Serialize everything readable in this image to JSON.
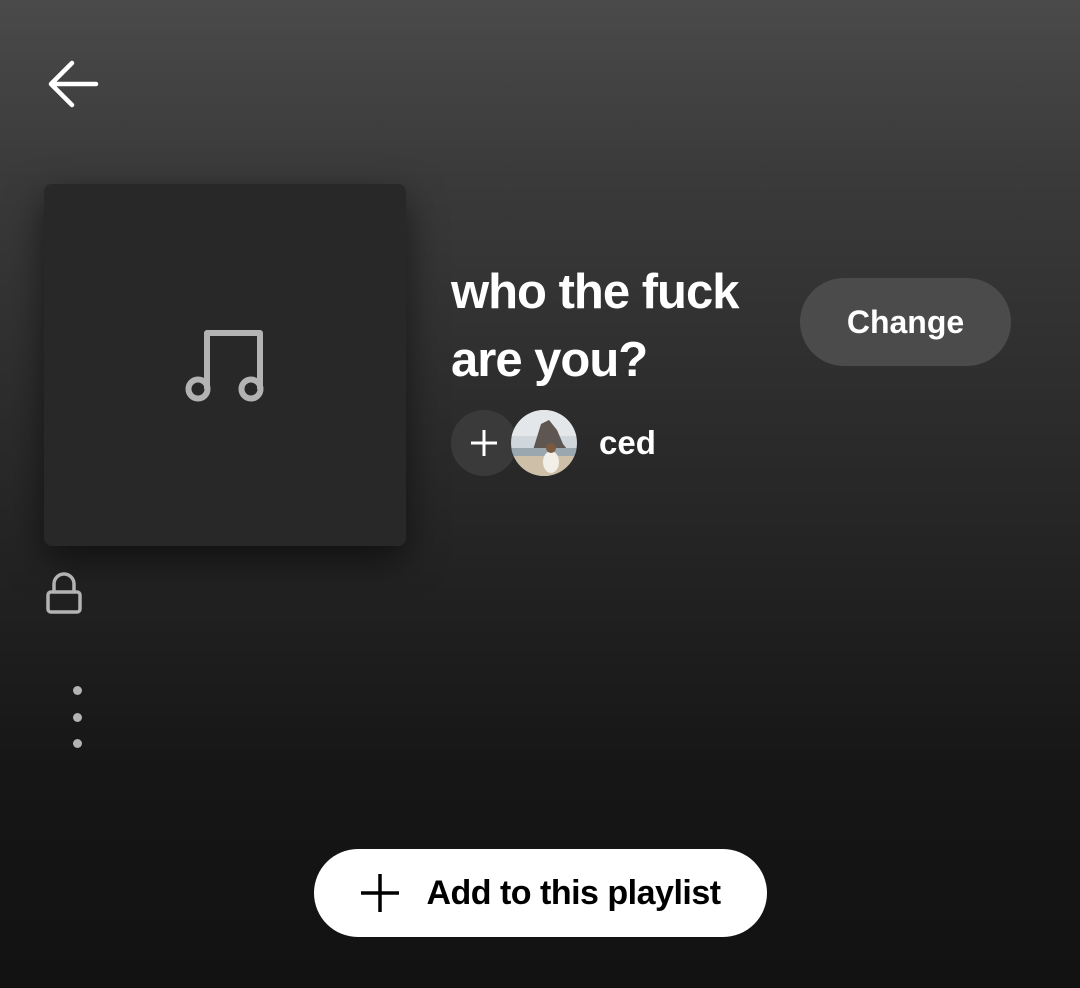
{
  "header": {
    "back_icon": "arrow-left-icon"
  },
  "playlist": {
    "title": "who the fuck are you?",
    "cover_icon": "music-note-icon",
    "change_label": "Change",
    "owner_name": "ced",
    "add_collaborator_icon": "plus-icon",
    "privacy_icon": "lock-icon",
    "more_icon": "more-vertical-icon"
  },
  "actions": {
    "add_label": "Add to this playlist",
    "add_icon": "plus-icon"
  },
  "colors": {
    "background_top": "#4a4a4a",
    "background_bottom": "#121212",
    "cover_bg": "#282828",
    "change_button_bg": "#4b4b4b",
    "primary_button_bg": "#ffffff",
    "icon_gray": "#b3b3b3"
  }
}
